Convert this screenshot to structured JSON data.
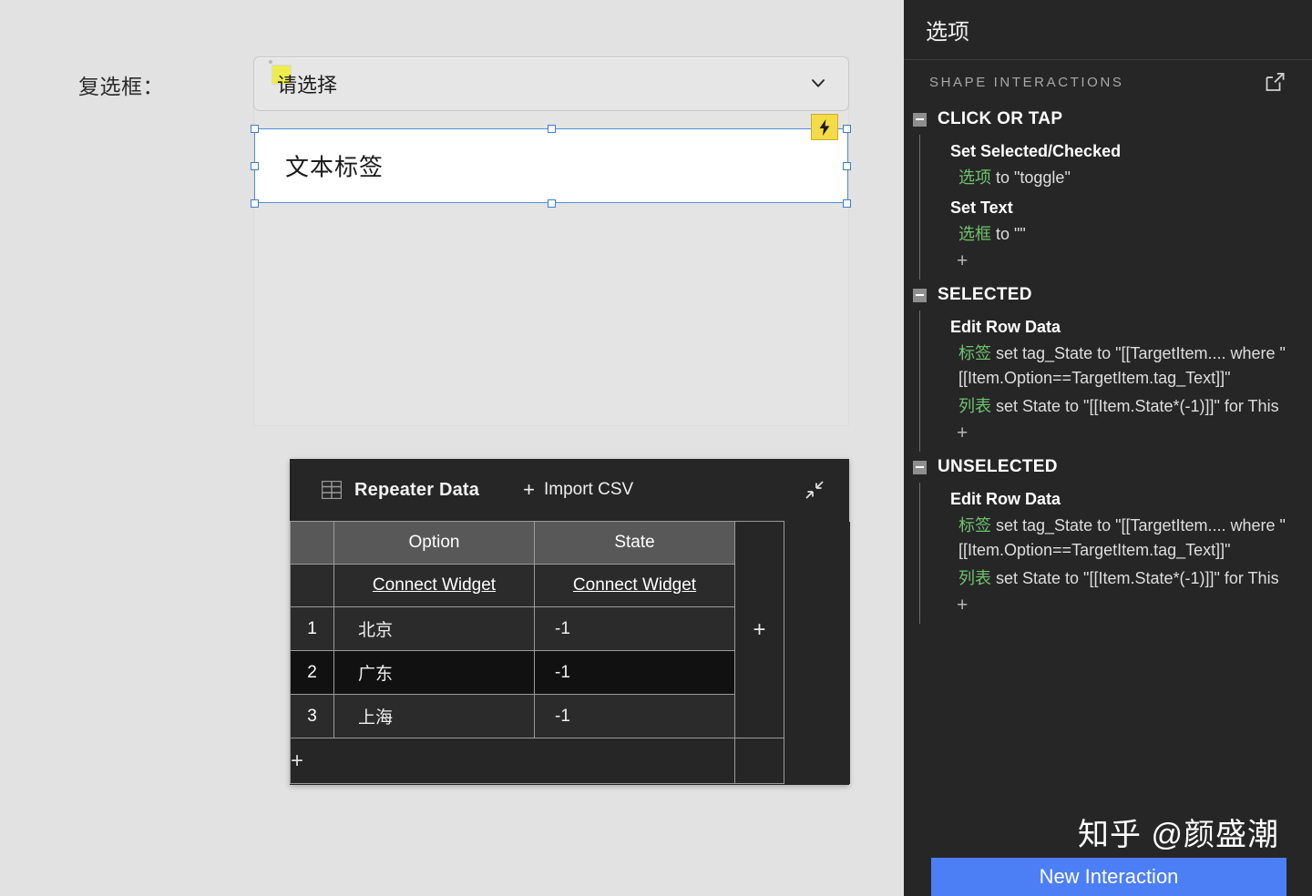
{
  "canvas": {
    "field_label": "复选框：",
    "select": {
      "value": "请选择",
      "note_marker": "sticky-note-marker",
      "chevron": "chevron-down-icon"
    },
    "text_label": {
      "text": "文本标签",
      "badge": "interaction-bolt-icon"
    }
  },
  "repeater": {
    "grid_icon": "table-grid-icon",
    "title": "Repeater Data",
    "import_plus": "+",
    "import_label": "Import CSV",
    "collapse_icon": "collapse-diagonal-icon",
    "columns": [
      "Option",
      "State"
    ],
    "connect_widget_label": "Connect Widget",
    "add_column_label": "+",
    "add_row_label": "+",
    "rows": [
      {
        "num": "1",
        "option": "北京",
        "state": "-1",
        "selected": false
      },
      {
        "num": "2",
        "option": "广东",
        "state": "-1",
        "selected": true
      },
      {
        "num": "3",
        "option": "上海",
        "state": "-1",
        "selected": false
      }
    ]
  },
  "panel": {
    "title": "选项",
    "section_caption": "SHAPE INTERACTIONS",
    "external_icon": "open-external-icon",
    "add_label": "+",
    "events": [
      {
        "name": "CLICK OR TAP",
        "actions": [
          {
            "name": "Set Selected/Checked",
            "details": [
              {
                "target": "选项",
                "text": " to \"toggle\""
              }
            ]
          },
          {
            "name": "Set Text",
            "details": [
              {
                "target": "选框",
                "text": " to \"\""
              }
            ]
          }
        ]
      },
      {
        "name": "SELECTED",
        "actions": [
          {
            "name": "Edit Row Data",
            "details": [
              {
                "target": "标签",
                "text": " set tag_State to \"[[TargetItem.... where \"[[Item.Option==TargetItem.tag_Text]]\""
              },
              {
                "target": "列表",
                "text": " set State to \"[[Item.State*(-1)]]\" for This"
              }
            ]
          }
        ]
      },
      {
        "name": "UNSELECTED",
        "actions": [
          {
            "name": "Edit Row Data",
            "details": [
              {
                "target": "标签",
                "text": " set tag_State to \"[[TargetItem.... where \"[[Item.Option==TargetItem.tag_Text]]\""
              },
              {
                "target": "列表",
                "text": " set State to \"[[Item.State*(-1)]]\" for This"
              }
            ]
          }
        ]
      }
    ],
    "new_interaction_label": "New Interaction"
  },
  "watermark": "知乎 @颜盛潮",
  "colors": {
    "accent_blue": "#4c7ef5",
    "selection_blue": "#4d90d6",
    "target_green": "#6fc26f",
    "badge_yellow": "#f4db48",
    "panel_bg": "#262626",
    "canvas_bg": "#e2e2e2"
  }
}
